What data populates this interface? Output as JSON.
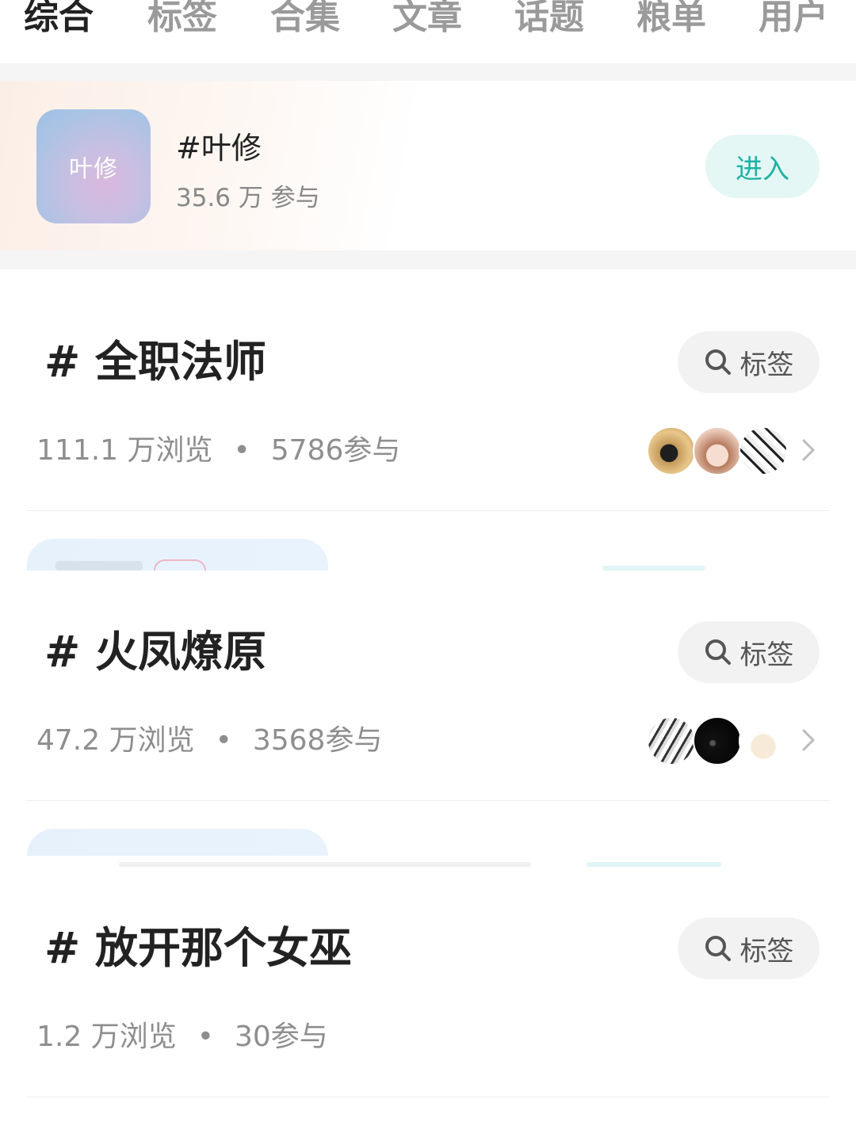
{
  "tabs": [
    {
      "label": "综合",
      "active": true
    },
    {
      "label": "标签",
      "active": false
    },
    {
      "label": "合集",
      "active": false
    },
    {
      "label": "文章",
      "active": false
    },
    {
      "label": "话题",
      "active": false
    },
    {
      "label": "粮单",
      "active": false
    },
    {
      "label": "用户",
      "active": false
    }
  ],
  "topic": {
    "thumb_text": "叶修",
    "title": "#叶修",
    "stats": "35.6 万 参与",
    "enter_label": "进入"
  },
  "tags": [
    {
      "title": "# 全职法师",
      "button_label": "标签",
      "views": "111.1 万浏览",
      "dot": "•",
      "participants": "5786参与"
    },
    {
      "title": "# 火凤燎原",
      "button_label": "标签",
      "views": "47.2 万浏览",
      "dot": "•",
      "participants": "3568参与"
    },
    {
      "title": "# 放开那个女巫",
      "button_label": "标签",
      "views": "1.2 万浏览",
      "dot": "•",
      "participants": "30参与"
    }
  ],
  "colors": {
    "accent": "#1fb3a5",
    "accent_bg": "#e4f7f5",
    "muted_text": "#8e8e8e",
    "title_text": "#222222"
  },
  "icons": {
    "tag_button": "search-icon",
    "row_arrow": "chevron-right-icon"
  }
}
